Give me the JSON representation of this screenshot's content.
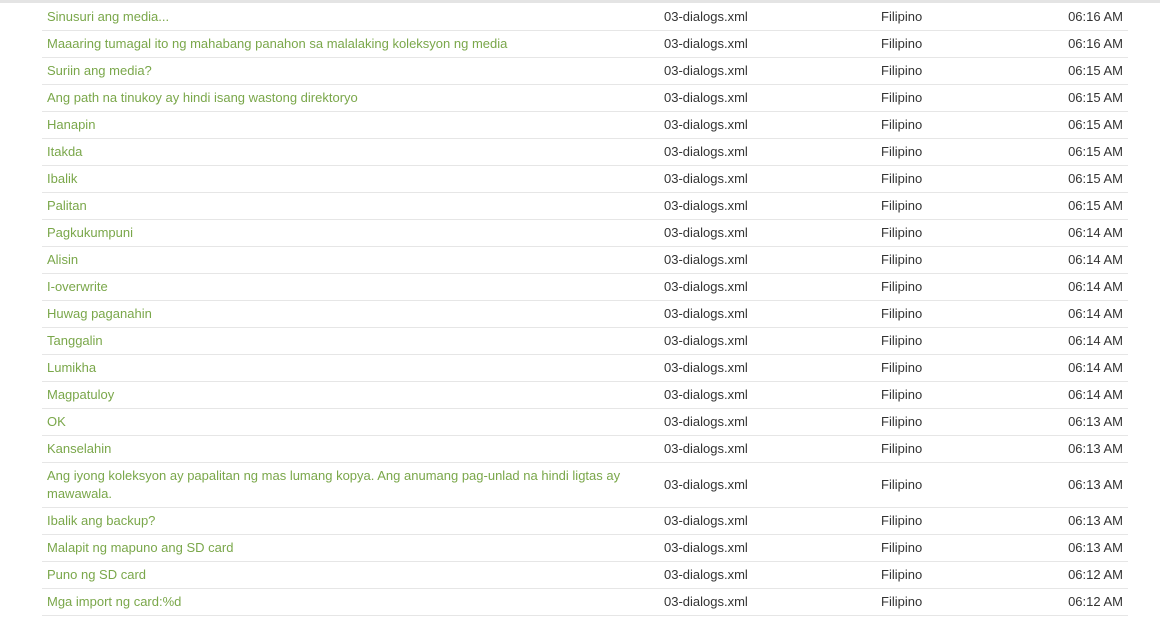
{
  "entries": [
    {
      "text": "Sinusuri ang media...",
      "file": "03-dialogs.xml",
      "language": "Filipino",
      "time": "06:16 AM"
    },
    {
      "text": "Maaaring tumagal ito ng mahabang panahon sa malalaking koleksyon ng media",
      "file": "03-dialogs.xml",
      "language": "Filipino",
      "time": "06:16 AM"
    },
    {
      "text": "Suriin ang media?",
      "file": "03-dialogs.xml",
      "language": "Filipino",
      "time": "06:15 AM"
    },
    {
      "text": "Ang path na tinukoy ay hindi isang wastong direktoryo",
      "file": "03-dialogs.xml",
      "language": "Filipino",
      "time": "06:15 AM"
    },
    {
      "text": "Hanapin",
      "file": "03-dialogs.xml",
      "language": "Filipino",
      "time": "06:15 AM"
    },
    {
      "text": "Itakda",
      "file": "03-dialogs.xml",
      "language": "Filipino",
      "time": "06:15 AM"
    },
    {
      "text": "Ibalik",
      "file": "03-dialogs.xml",
      "language": "Filipino",
      "time": "06:15 AM"
    },
    {
      "text": "Palitan",
      "file": "03-dialogs.xml",
      "language": "Filipino",
      "time": "06:15 AM"
    },
    {
      "text": "Pagkukumpuni",
      "file": "03-dialogs.xml",
      "language": "Filipino",
      "time": "06:14 AM"
    },
    {
      "text": "Alisin",
      "file": "03-dialogs.xml",
      "language": "Filipino",
      "time": "06:14 AM"
    },
    {
      "text": "I-overwrite",
      "file": "03-dialogs.xml",
      "language": "Filipino",
      "time": "06:14 AM"
    },
    {
      "text": "Huwag paganahin",
      "file": "03-dialogs.xml",
      "language": "Filipino",
      "time": "06:14 AM"
    },
    {
      "text": "Tanggalin",
      "file": "03-dialogs.xml",
      "language": "Filipino",
      "time": "06:14 AM"
    },
    {
      "text": "Lumikha",
      "file": "03-dialogs.xml",
      "language": "Filipino",
      "time": "06:14 AM"
    },
    {
      "text": "Magpatuloy",
      "file": "03-dialogs.xml",
      "language": "Filipino",
      "time": "06:14 AM"
    },
    {
      "text": "OK",
      "file": "03-dialogs.xml",
      "language": "Filipino",
      "time": "06:13 AM"
    },
    {
      "text": "Kanselahin",
      "file": "03-dialogs.xml",
      "language": "Filipino",
      "time": "06:13 AM"
    },
    {
      "text": "Ang iyong koleksyon ay papalitan ng mas lumang kopya. Ang anumang pag-unlad na hindi ligtas ay mawawala.",
      "file": "03-dialogs.xml",
      "language": "Filipino",
      "time": "06:13 AM"
    },
    {
      "text": "Ibalik ang backup?",
      "file": "03-dialogs.xml",
      "language": "Filipino",
      "time": "06:13 AM"
    },
    {
      "text": "Malapit ng mapuno ang SD card",
      "file": "03-dialogs.xml",
      "language": "Filipino",
      "time": "06:13 AM"
    },
    {
      "text": "Puno ng SD card",
      "file": "03-dialogs.xml",
      "language": "Filipino",
      "time": "06:12 AM"
    },
    {
      "text": "Mga import ng card:%d",
      "file": "03-dialogs.xml",
      "language": "Filipino",
      "time": "06:12 AM"
    }
  ],
  "colors": {
    "link": "#7aa74a",
    "text": "#333333",
    "row_border": "#e6e6e6"
  }
}
